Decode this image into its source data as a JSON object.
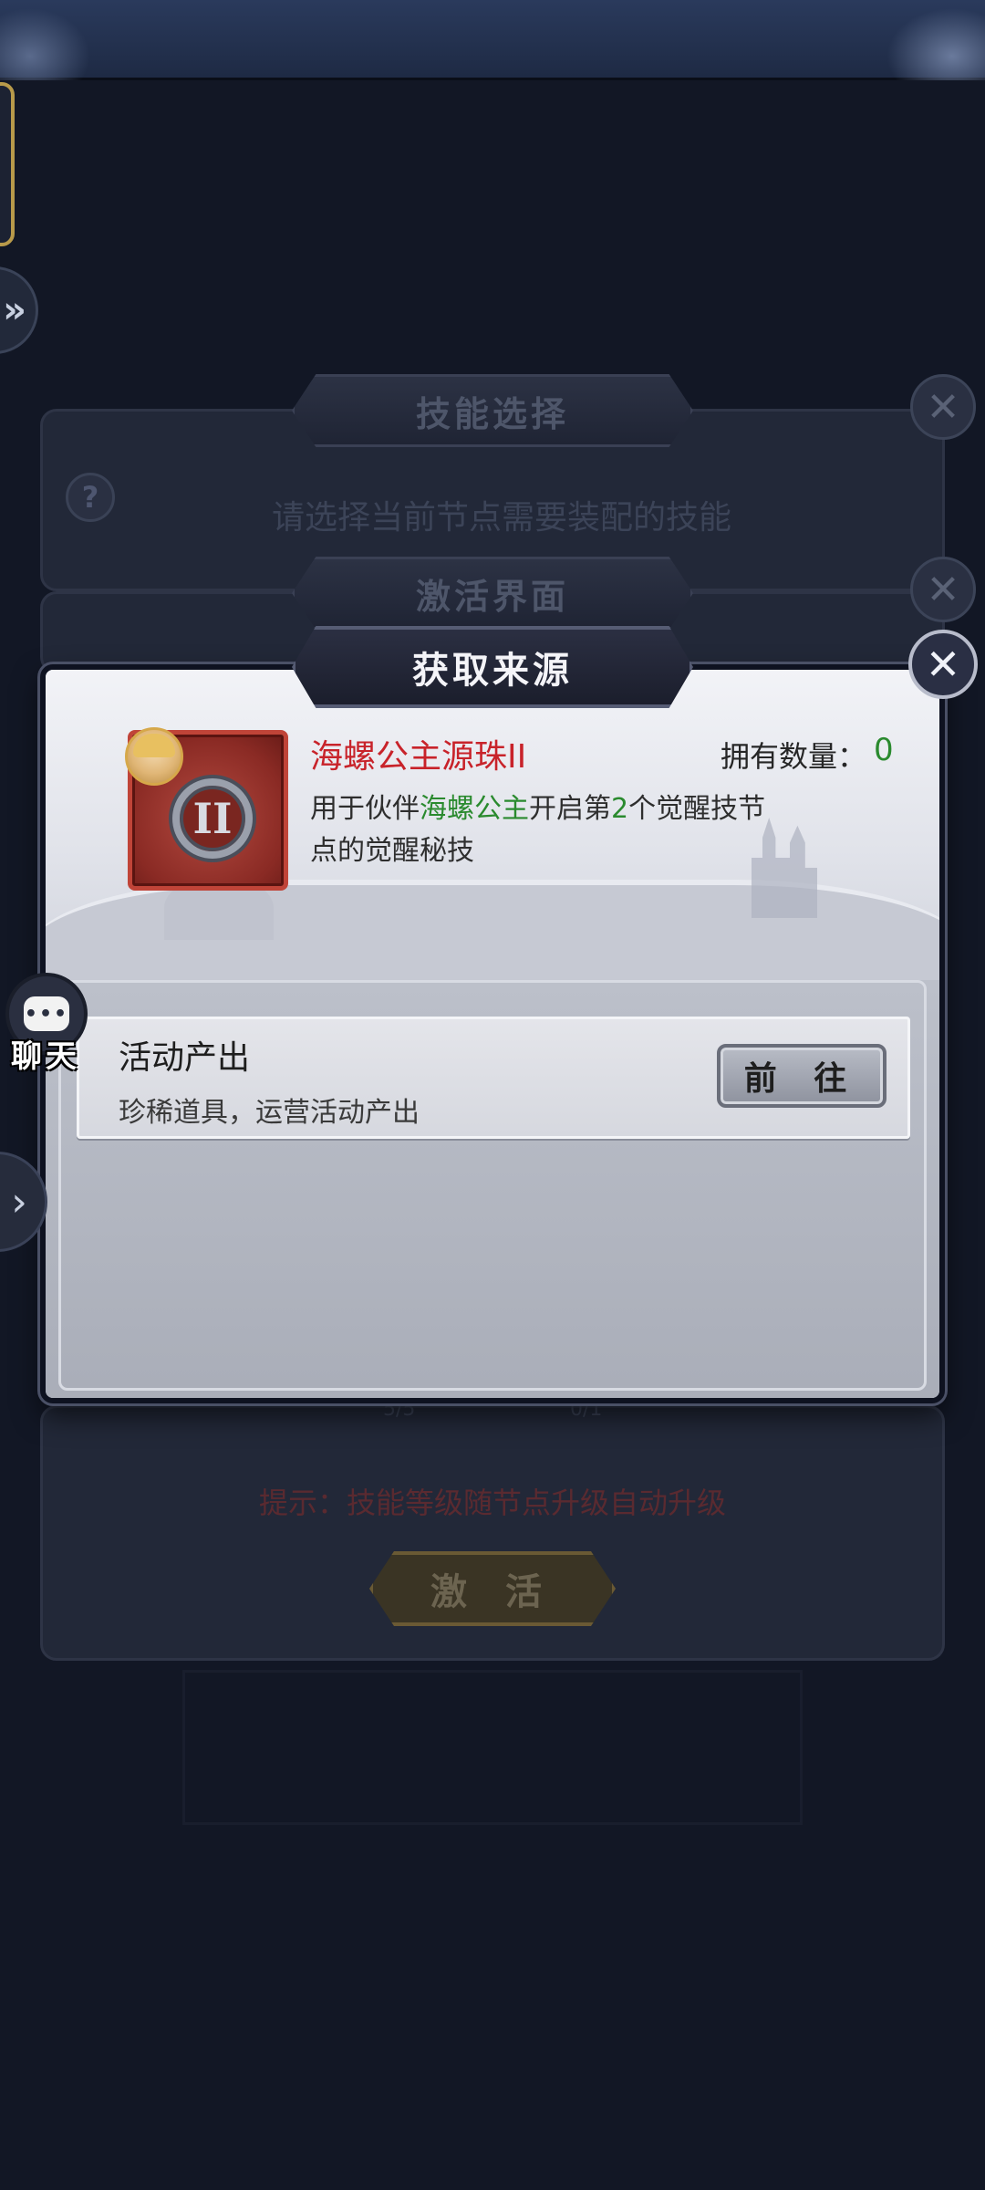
{
  "background": {
    "skill_select_title": "技能选择",
    "skill_prompt": "请选择当前节点需要装配的技能",
    "activate_title": "激活界面",
    "count_left": "5/5",
    "count_right": "0/1",
    "tip": "提示：技能等级随节点升级自动升级",
    "activate_button": "激 活"
  },
  "dialog": {
    "title": "获取来源",
    "item": {
      "name": "海螺公主源珠II",
      "emblem": "II",
      "owned_label": "拥有数量：",
      "owned_value": "0",
      "desc_line1_pre": "用于伙伴",
      "desc_partner": "海螺公主",
      "desc_line1_mid": "开启第",
      "desc_number": "2",
      "desc_line1_post": "个觉醒技节",
      "desc_line2": "点的觉醒秘技"
    },
    "sources": [
      {
        "title": "活动产出",
        "desc": "珍稀道具，运营活动产出",
        "button": "前 往"
      }
    ]
  },
  "chat": {
    "label": "聊天",
    "icon_text": "•••"
  },
  "icons": {
    "close": "close-icon",
    "arrow": "chevron-right-icon",
    "chat": "chat-icon",
    "help": "help-icon"
  },
  "colors": {
    "item_name": "#c8232a",
    "highlight": "#2a8a2e",
    "dialog_bg": "#c9ccd6"
  }
}
